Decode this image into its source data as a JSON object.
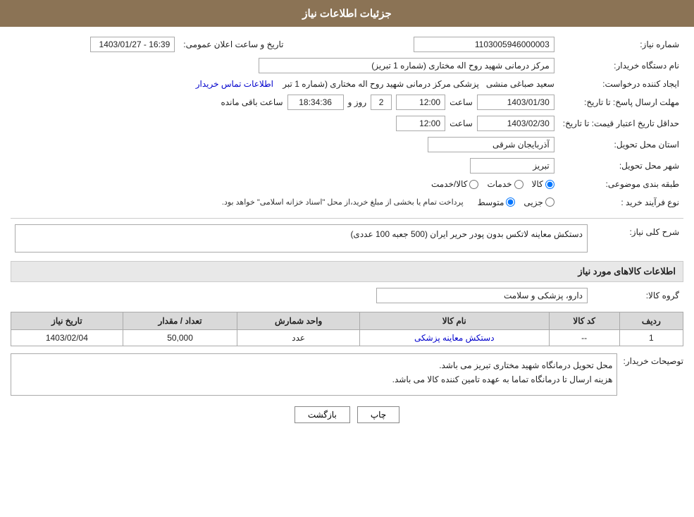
{
  "header": {
    "title": "جزئیات اطلاعات نیاز"
  },
  "fields": {
    "need_number_label": "شماره نیاز:",
    "need_number_value": "1103005946000003",
    "buyer_org_label": "نام دستگاه خریدار:",
    "buyer_org_value": "مرکز درمانی شهید روح اله مختاری (شماره 1 تبریز)",
    "requester_label": "ایجاد کننده درخواست:",
    "requester_name": "سعید صباغی منشی",
    "requester_position": "پزشکی مرکز درمانی شهید روح اله مختاری (شماره 1 تبر",
    "requester_contact_link": "اطلاعات تماس خریدار",
    "announce_date_label": "تاریخ و ساعت اعلان عمومی:",
    "announce_date_value": "1403/01/27 - 16:39",
    "send_deadline_label": "مهلت ارسال پاسخ: تا تاریخ:",
    "send_date": "1403/01/30",
    "send_time": "12:00",
    "send_days": "2",
    "send_remaining_label": "ساعت باقی مانده",
    "send_remaining_time": "18:34:36",
    "send_remaining_unit": "روز و",
    "price_validity_label": "حداقل تاریخ اعتبار قیمت: تا تاریخ:",
    "price_date": "1403/02/30",
    "price_time": "12:00",
    "province_label": "استان محل تحویل:",
    "province_value": "آذربایجان شرقی",
    "city_label": "شهر محل تحویل:",
    "city_value": "تبریز",
    "category_label": "طبقه بندی موضوعی:",
    "category_options": [
      {
        "id": "kala",
        "label": "کالا",
        "checked": true
      },
      {
        "id": "khadamat",
        "label": "خدمات",
        "checked": false
      },
      {
        "id": "kala_khadamat",
        "label": "کالا/خدمت",
        "checked": false
      }
    ],
    "process_label": "نوع فرآیند خرید :",
    "process_options": [
      {
        "id": "jazii",
        "label": "جزیی",
        "checked": false
      },
      {
        "id": "motavaset",
        "label": "متوسط",
        "checked": true
      }
    ],
    "process_note": "پرداخت تمام یا بخشی از مبلغ خرید،از محل \"اسناد خزانه اسلامی\" خواهد بود.",
    "description_label": "شرح کلی نیاز:",
    "description_value": "دستکش معاینه لاتکس بدون پودر حریر ایران (500 جعبه 100 عددی)",
    "items_title": "اطلاعات کالاهای مورد نیاز",
    "goods_group_label": "گروه کالا:",
    "goods_group_value": "دارو، پزشکی و سلامت",
    "table": {
      "headers": [
        "ردیف",
        "کد کالا",
        "نام کالا",
        "واحد شمارش",
        "تعداد / مقدار",
        "تاریخ نیاز"
      ],
      "rows": [
        {
          "row_num": "1",
          "product_code": "--",
          "product_name": "دستکش معاینه پزشکی",
          "unit": "عدد",
          "quantity": "50,000",
          "need_date": "1403/02/04"
        }
      ]
    },
    "buyer_notes_label": "توصیحات خریدار:",
    "buyer_notes_line1": "محل تحویل درمانگاه شهید مختاری تبریز می باشد.",
    "buyer_notes_line2": "هزینه ارسال تا درمانگاه تماما به عهده تامین کننده کالا می باشد.",
    "btn_print": "چاپ",
    "btn_back": "بازگشت"
  }
}
